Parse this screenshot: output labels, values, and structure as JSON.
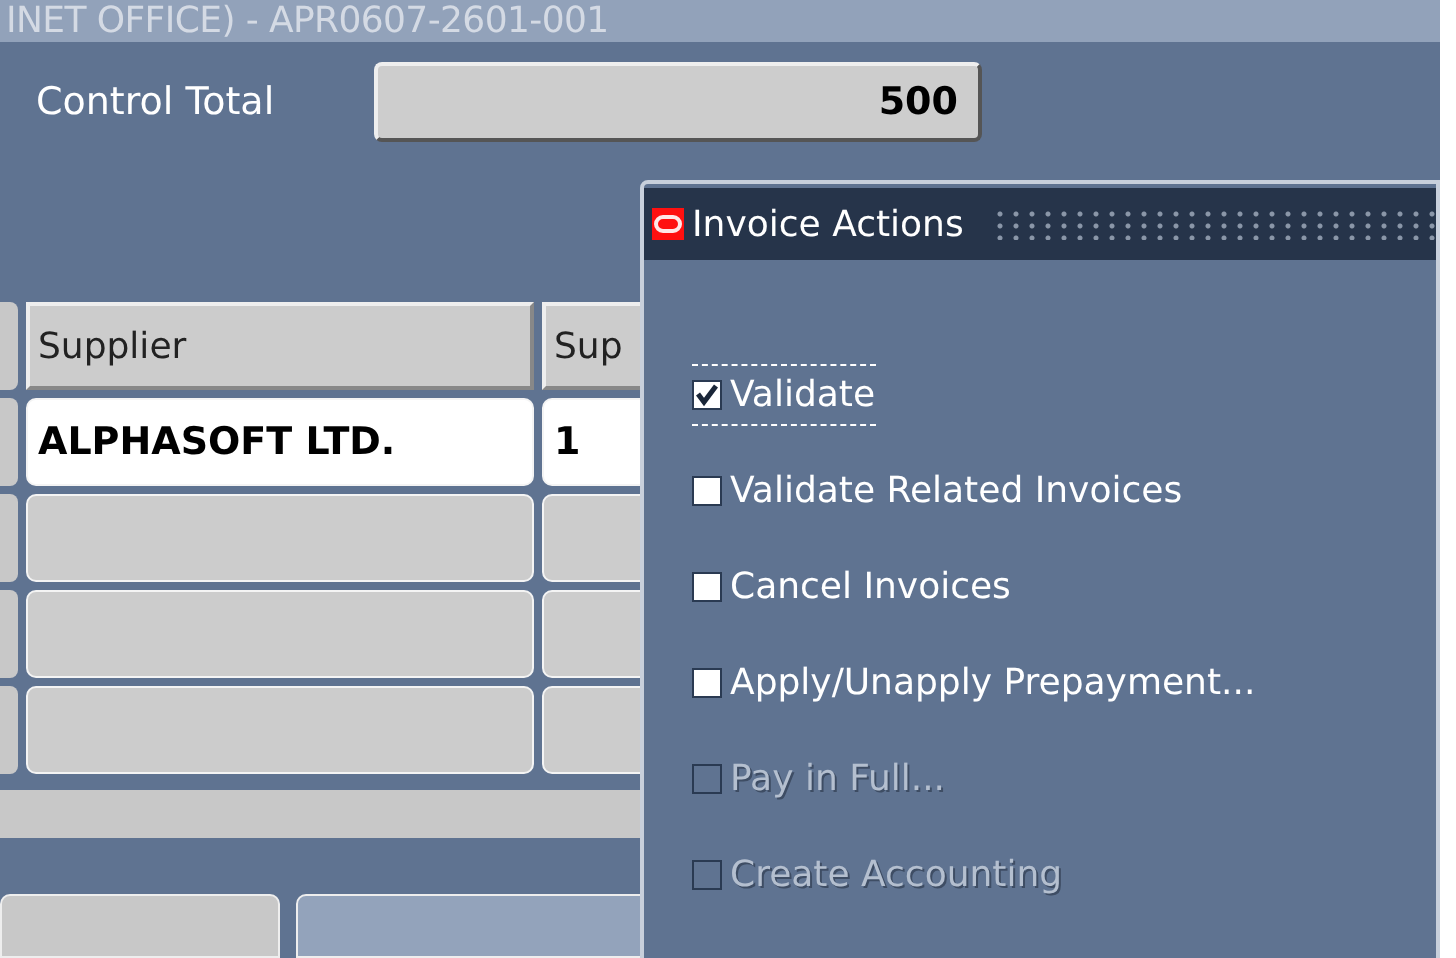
{
  "window": {
    "title": "INET OFFICE) - APR0607-2601-001"
  },
  "control_total": {
    "label": "Control Total",
    "value": "500"
  },
  "table": {
    "columns": [
      "Supplier",
      "Sup"
    ],
    "rows": [
      {
        "cells": [
          "ALPHASOFT LTD.",
          "1"
        ],
        "selected": true
      },
      {
        "cells": [
          "",
          ""
        ],
        "selected": false
      },
      {
        "cells": [
          "",
          ""
        ],
        "selected": false
      },
      {
        "cells": [
          "",
          ""
        ],
        "selected": false
      }
    ]
  },
  "dialog": {
    "title": "Invoice Actions",
    "items": [
      {
        "label": "Validate",
        "checked": true,
        "disabled": false,
        "focused": true
      },
      {
        "label": "Validate Related Invoices",
        "checked": false,
        "disabled": false,
        "focused": false
      },
      {
        "label": "Cancel Invoices",
        "checked": false,
        "disabled": false,
        "focused": false
      },
      {
        "label": "Apply/Unapply Prepayment...",
        "checked": false,
        "disabled": false,
        "focused": false
      },
      {
        "label": "Pay in Full...",
        "checked": false,
        "disabled": true,
        "focused": false
      },
      {
        "label": "Create Accounting",
        "checked": false,
        "disabled": true,
        "focused": false
      }
    ]
  }
}
